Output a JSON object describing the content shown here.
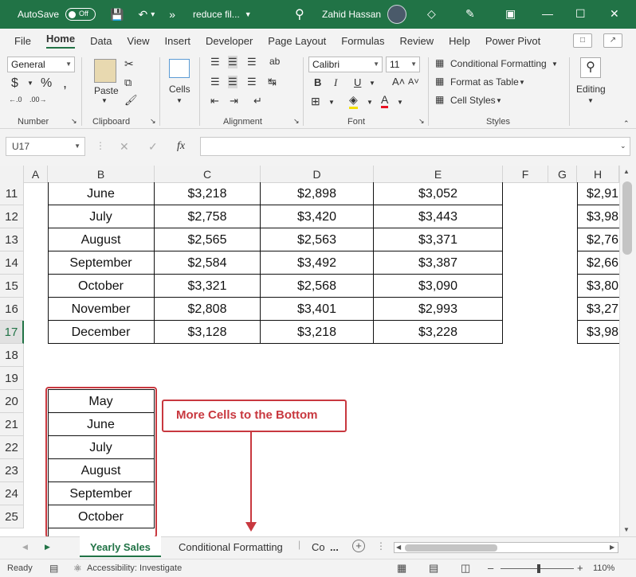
{
  "titlebar": {
    "autosave_label": "AutoSave",
    "autosave_state": "Off",
    "doc_name": "reduce fil...",
    "user_name": "Zahid Hassan",
    "overflow": "»"
  },
  "menu": [
    "File",
    "Home",
    "Data",
    "View",
    "Insert",
    "Developer",
    "Page Layout",
    "Formulas",
    "Review",
    "Help",
    "Power Pivot"
  ],
  "ribbon": {
    "number_format": "General",
    "number_label": "Number",
    "clipboard_label": "Clipboard",
    "paste_label": "Paste",
    "cells_label": "Cells",
    "alignment_label": "Alignment",
    "font_name": "Calibri",
    "font_size": "11",
    "font_label": "Font",
    "conditional_formatting": "Conditional Formatting",
    "format_as_table": "Format as Table",
    "cell_styles": "Cell Styles",
    "styles_label": "Styles",
    "editing_label": "Editing",
    "symbols": {
      "dollar": "$",
      "percent": "%",
      "comma": ",",
      "bold": "B",
      "italic": "I",
      "underline": "U",
      "text_color": "A",
      "fx": "fx"
    }
  },
  "formula_bar": {
    "name_box": "U17",
    "formula": ""
  },
  "columns": [
    "A",
    "B",
    "C",
    "D",
    "E",
    "F",
    "G",
    "H"
  ],
  "rows": [
    {
      "num": "11",
      "b": "June",
      "c": "$3,218",
      "d": "$2,898",
      "e": "$3,052",
      "h": "$2,91"
    },
    {
      "num": "12",
      "b": "July",
      "c": "$2,758",
      "d": "$3,420",
      "e": "$3,443",
      "h": "$3,98"
    },
    {
      "num": "13",
      "b": "August",
      "c": "$2,565",
      "d": "$2,563",
      "e": "$3,371",
      "h": "$2,76"
    },
    {
      "num": "14",
      "b": "September",
      "c": "$2,584",
      "d": "$3,492",
      "e": "$3,387",
      "h": "$2,66"
    },
    {
      "num": "15",
      "b": "October",
      "c": "$3,321",
      "d": "$2,568",
      "e": "$3,090",
      "h": "$3,80"
    },
    {
      "num": "16",
      "b": "November",
      "c": "$2,808",
      "d": "$3,401",
      "e": "$2,993",
      "h": "$3,27"
    },
    {
      "num": "17",
      "b": "December",
      "c": "$3,128",
      "d": "$3,218",
      "e": "$3,228",
      "h": "$3,98"
    }
  ],
  "empty_rows": [
    "18",
    "19"
  ],
  "lower_rows": [
    {
      "num": "20",
      "b": "May"
    },
    {
      "num": "21",
      "b": "June"
    },
    {
      "num": "22",
      "b": "July"
    },
    {
      "num": "23",
      "b": "August"
    },
    {
      "num": "24",
      "b": "September"
    },
    {
      "num": "25",
      "b": "October"
    }
  ],
  "callout": "More Cells to the Bottom",
  "sheets": {
    "active": "Yearly Sales",
    "second": "Conditional Formatting",
    "third": "Co",
    "ellipsis": "..."
  },
  "status": {
    "ready": "Ready",
    "accessibility": "Accessibility: Investigate",
    "zoom": "110%"
  },
  "colors": {
    "excel_green": "#217346",
    "annotation_red": "#c8383f"
  }
}
